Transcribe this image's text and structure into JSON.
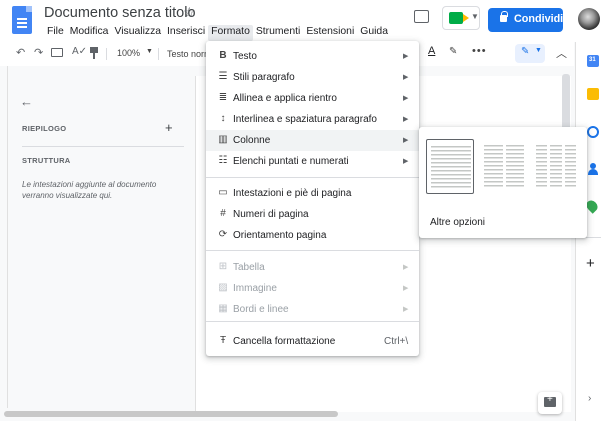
{
  "header": {
    "doc_title": "Documento senza titolo",
    "star_icon": "star-outline-icon",
    "menu": [
      "File",
      "Modifica",
      "Visualizza",
      "Inserisci",
      "Formato",
      "Strumenti",
      "Estensioni",
      "Guida"
    ],
    "active_menu": "Formato",
    "share_label": "Condividi"
  },
  "toolbar": {
    "zoom": "100%",
    "style": "Testo norm"
  },
  "outline": {
    "summary_label": "RIEPILOGO",
    "structure_label": "STRUTTURA",
    "structure_hint": "Le intestazioni aggiunte al documento verranno visualizzate qui."
  },
  "format_menu": {
    "items": [
      {
        "label": "Testo",
        "icon": "bold-icon",
        "glyph": "B",
        "submenu": true,
        "disabled": false
      },
      {
        "label": "Stili paragrafo",
        "icon": "paragraph-styles-icon",
        "glyph": "☰",
        "submenu": true,
        "disabled": false
      },
      {
        "label": "Allinea e applica rientro",
        "icon": "align-indent-icon",
        "glyph": "≣",
        "submenu": true,
        "disabled": false
      },
      {
        "label": "Interlinea e spaziatura paragrafo",
        "icon": "line-spacing-icon",
        "glyph": "↕",
        "submenu": true,
        "disabled": false
      },
      {
        "label": "Colonne",
        "icon": "columns-icon",
        "glyph": "▥",
        "submenu": true,
        "disabled": false,
        "highlighted": true
      },
      {
        "label": "Elenchi puntati e numerati",
        "icon": "list-icon",
        "glyph": "☷",
        "submenu": true,
        "disabled": false
      },
      {
        "label": "Intestazioni e piè di pagina",
        "icon": "header-footer-icon",
        "glyph": "▭",
        "submenu": false,
        "disabled": false
      },
      {
        "label": "Numeri di pagina",
        "icon": "hash-icon",
        "glyph": "#",
        "submenu": false,
        "disabled": false
      },
      {
        "label": "Orientamento pagina",
        "icon": "page-orientation-icon",
        "glyph": "⟳",
        "submenu": false,
        "disabled": false
      },
      {
        "label": "Tabella",
        "icon": "table-icon",
        "glyph": "⊞",
        "submenu": true,
        "disabled": true
      },
      {
        "label": "Immagine",
        "icon": "image-icon",
        "glyph": "▨",
        "submenu": true,
        "disabled": true
      },
      {
        "label": "Bordi e linee",
        "icon": "borders-icon",
        "glyph": "▦",
        "submenu": true,
        "disabled": true
      },
      {
        "label": "Cancella formattazione",
        "icon": "clear-format-icon",
        "glyph": "Ŧ",
        "submenu": false,
        "disabled": false,
        "shortcut": "Ctrl+\\"
      }
    ]
  },
  "columns_submenu": {
    "presets": [
      {
        "name": "one-column",
        "columns": 1,
        "selected": true
      },
      {
        "name": "two-columns",
        "columns": 2,
        "selected": false
      },
      {
        "name": "three-columns",
        "columns": 3,
        "selected": false
      }
    ],
    "more_options": "Altre opzioni"
  },
  "colors": {
    "share_blue": "#1a73e8",
    "doc_blue": "#4285f4",
    "menu_highlight": "#f1f3f4"
  }
}
